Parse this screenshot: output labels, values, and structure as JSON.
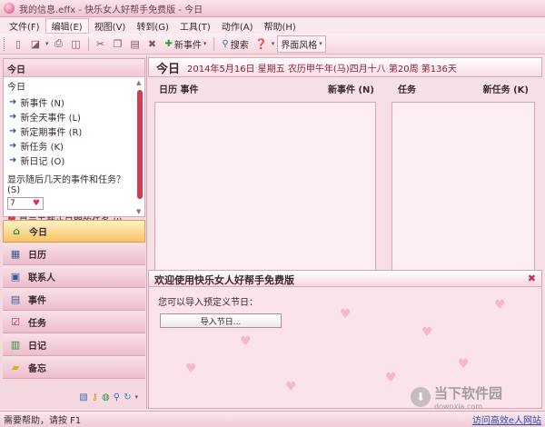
{
  "window": {
    "title": "我的信息.effx - 快乐女人好帮手免费版 - 今日"
  },
  "menu": [
    "文件(F)",
    "编辑(E)",
    "视图(V)",
    "转到(G)",
    "工具(T)",
    "动作(A)",
    "帮助(H)"
  ],
  "toolbar": {
    "new_event": "新事件",
    "search": "搜索",
    "ui_style": "界面风格"
  },
  "left": {
    "panel_title": "今日",
    "sub_title": "今日",
    "actions": [
      "新事件 (N)",
      "新全天事件 (L)",
      "新定期事件 (R)",
      "新任务 (K)",
      "新日记 (O)"
    ],
    "days_question": "显示随后几天的事件和任务？ (S)",
    "days_value": "7",
    "undated_tasks": "显示无截止日期的任务 (I)"
  },
  "nav": [
    {
      "label": "今日",
      "icon": "home-icon"
    },
    {
      "label": "日历",
      "icon": "calendar-icon"
    },
    {
      "label": "联系人",
      "icon": "contacts-icon"
    },
    {
      "label": "事件",
      "icon": "events-icon"
    },
    {
      "label": "任务",
      "icon": "tasks-icon"
    },
    {
      "label": "日记",
      "icon": "diary-icon"
    },
    {
      "label": "备忘",
      "icon": "memo-icon"
    }
  ],
  "header": {
    "today_label": "今日",
    "date_info": "2014年5月16日 星期五 农历甲午年(马)四月十八  第20周 第136天"
  },
  "calendar": {
    "col_left": "日历 事件",
    "col_right": "新事件 (N)"
  },
  "tasks": {
    "col_left": "任务",
    "col_right": "新任务 (K)"
  },
  "welcome": {
    "title": "欢迎使用快乐女人好帮手免费版",
    "text": "您可以导入预定义节日：",
    "import_button": "导入节日..."
  },
  "status": {
    "help_text": "需要帮助，请按 F1",
    "link": "访问高效e人网站"
  },
  "watermark": {
    "brand": "当下软件园",
    "url": "downxia.com"
  }
}
